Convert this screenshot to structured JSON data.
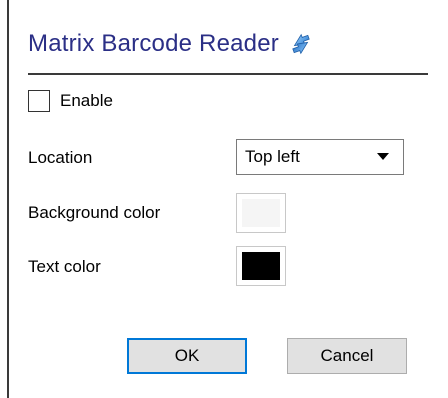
{
  "dialog": {
    "title": "Matrix Barcode Reader",
    "title_icon": "refresh-arrows-icon",
    "title_color": "#2b2f86",
    "enable": {
      "label": "Enable",
      "checked": false
    },
    "location": {
      "label": "Location",
      "selected": "Top left"
    },
    "background_color": {
      "label": "Background color",
      "value": "#f5f5f5"
    },
    "text_color": {
      "label": "Text color",
      "value": "#000000"
    },
    "buttons": {
      "ok_label": "OK",
      "cancel_label": "Cancel",
      "focus_color": "#0078d7"
    }
  }
}
